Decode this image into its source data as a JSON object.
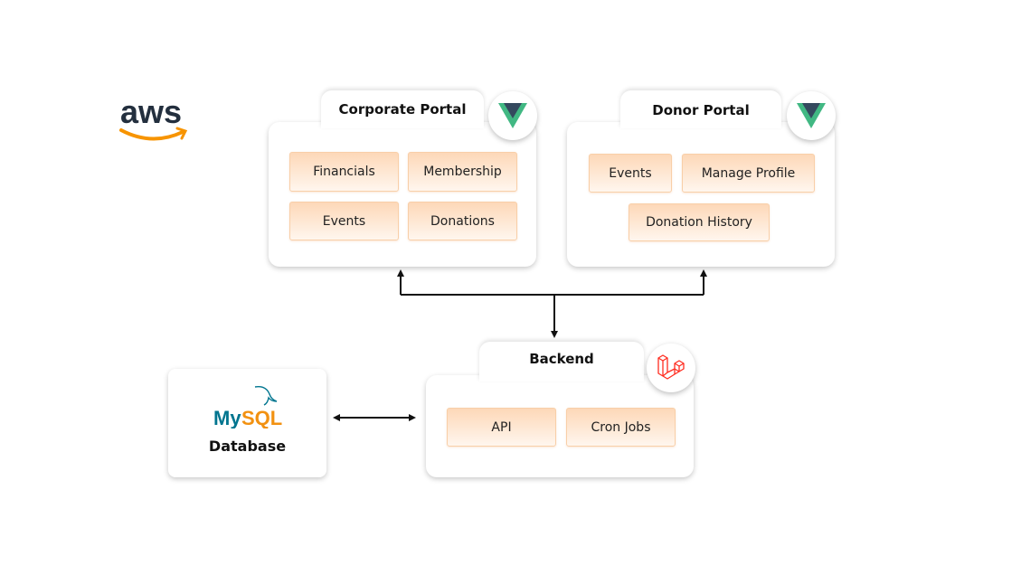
{
  "logo": {
    "text": "aws",
    "colors": {
      "text": "#232f3e",
      "smile": "#f79400"
    }
  },
  "corporate_portal": {
    "title": "Corporate Portal",
    "icon": "vue-icon",
    "modules": [
      "Financials",
      "Membership",
      "Events",
      "Donations"
    ]
  },
  "donor_portal": {
    "title": "Donor Portal",
    "icon": "vue-icon",
    "modules": [
      "Events",
      "Manage Profile",
      "Donation History"
    ]
  },
  "backend": {
    "title": "Backend",
    "icon": "laravel-icon",
    "modules": [
      "API",
      "Cron Jobs"
    ]
  },
  "database": {
    "logo_text": "MySQL",
    "title": "Database",
    "colors": {
      "my": "#00758f",
      "sql": "#f29111"
    }
  },
  "colors": {
    "vue_green": "#41b883",
    "vue_dark": "#34495e",
    "laravel_red": "#ff2d20",
    "chip_fill": "#fdd8b8"
  }
}
